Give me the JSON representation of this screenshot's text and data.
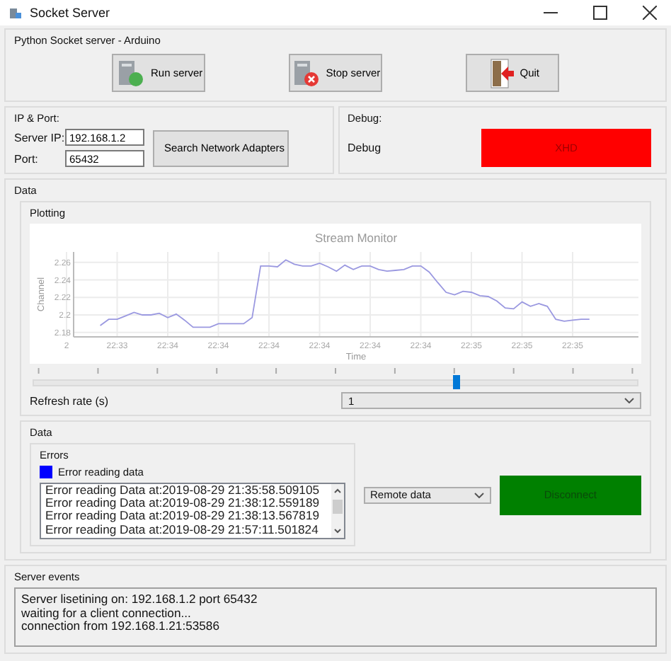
{
  "window": {
    "title": "Socket Server"
  },
  "server_group": {
    "title": "Python Socket server - Arduino",
    "buttons": [
      {
        "label": "Run server",
        "kind": "run"
      },
      {
        "label": "Stop server",
        "kind": "stop"
      },
      {
        "label": "Quit",
        "kind": "quit"
      }
    ]
  },
  "ip_port": {
    "title": "IP & Port:",
    "server_ip_label": "Server IP:",
    "server_ip": "192.168.1.2",
    "port_label": "Port:",
    "port": "65432",
    "search_button": "Search Network Adapters"
  },
  "debug": {
    "title": "Debug:",
    "label": "Debug",
    "button": "XHD"
  },
  "data": {
    "title": "Data",
    "plotting": {
      "title": "Plotting",
      "chart_data": {
        "type": "line",
        "title": "Stream Monitor",
        "xlabel": "Time",
        "ylabel": "Channel",
        "categories": [
          "2",
          null,
          null,
          null,
          null,
          null,
          "22:33",
          null,
          null,
          null,
          null,
          null,
          "22:34",
          null,
          null,
          null,
          null,
          null,
          "22:34",
          null,
          null,
          null,
          null,
          null,
          "22:34",
          null,
          null,
          null,
          null,
          null,
          "22:34",
          null,
          null,
          null,
          null,
          null,
          "22:34",
          null,
          null,
          null,
          null,
          null,
          "22:34",
          null,
          null,
          null,
          null,
          null,
          "22:35",
          null,
          null,
          null,
          null,
          null,
          "22:35",
          null,
          null,
          null,
          null,
          null,
          "22:35",
          null,
          null,
          null
        ],
        "series": [
          {
            "color": "#9a98e0",
            "values": [
              null,
              null,
              null,
              null,
              2.188,
              2.195,
              2.195,
              2.199,
              2.203,
              2.2,
              2.2,
              2.202,
              2.197,
              2.201,
              2.194,
              2.186,
              2.186,
              2.186,
              2.19,
              2.19,
              2.19,
              2.19,
              2.197,
              2.256,
              2.256,
              2.255,
              2.263,
              2.258,
              2.256,
              2.256,
              2.259,
              2.255,
              2.25,
              2.257,
              2.252,
              2.256,
              2.256,
              2.252,
              2.25,
              2.251,
              2.252,
              2.256,
              2.256,
              2.249,
              2.237,
              2.226,
              2.223,
              2.227,
              2.226,
              2.222,
              2.221,
              2.216,
              2.208,
              2.207,
              2.215,
              2.21,
              2.213,
              2.21,
              2.195,
              2.193,
              2.194,
              2.195,
              2.195,
              null
            ]
          }
        ],
        "ylim": [
          2.175,
          2.272
        ],
        "grid": true,
        "yticks": [
          2.18,
          2.2,
          2.22,
          2.24,
          2.26
        ]
      },
      "slider": {
        "level": 0.7
      },
      "refresh_label": "Refresh rate (s)",
      "refresh_value": "1"
    },
    "data_sub": {
      "title": "Data",
      "errors": {
        "title": "Errors",
        "legend": {
          "label": "Error reading data",
          "color": "#0000ff"
        },
        "lines": [
          "Error reading Data at:2019-08-29 21:35:58.509105",
          "Error reading Data at:2019-08-29 21:38:12.559189",
          "Error reading Data at:2019-08-29 21:38:13.567819",
          "Error reading Data at:2019-08-29 21:57:11.501824"
        ]
      },
      "source": "Remote data",
      "disconnect_button": "Disconnect"
    }
  },
  "server_events": {
    "title": "Server events",
    "lines": [
      "Server lisetining on: 192.168.1.2 port 65432",
      "waiting for a client connection...",
      "connection from 192.168.1.21:53586"
    ]
  }
}
